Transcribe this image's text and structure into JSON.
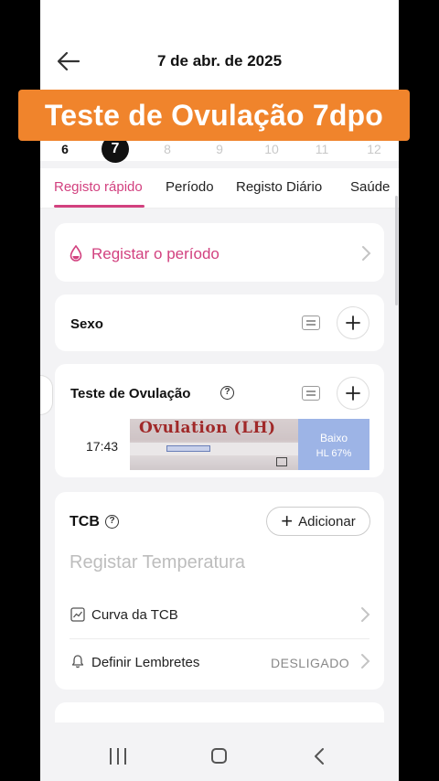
{
  "header": {
    "date_title": "7 de abr. de 2025"
  },
  "overlay": {
    "caption": "Teste de Ovulação 7dpo"
  },
  "day_strip": {
    "days": [
      "6",
      "7",
      "8",
      "9",
      "10",
      "11",
      "12"
    ],
    "selected_index": 1
  },
  "tabs": [
    {
      "label": "Registo rápido",
      "active": true
    },
    {
      "label": "Período",
      "active": false
    },
    {
      "label": "Registo Diário",
      "active": false
    },
    {
      "label": "Saúde",
      "active": false
    }
  ],
  "period_card": {
    "label": "Registar o período"
  },
  "sex_card": {
    "title": "Sexo"
  },
  "ovulation_card": {
    "title": "Teste de Ovulação",
    "entry_time": "17:43",
    "image_text": "Ovulation (LH)",
    "result_label": "Baixo",
    "result_value": "HL 67%"
  },
  "bbt_card": {
    "title": "TCB",
    "add_label": "Adicionar",
    "temperature_placeholder": "Registar Temperatura",
    "curve_label": "Curva da TCB",
    "reminders_label": "Definir Lembretes",
    "reminders_value": "DESLIGADO"
  },
  "colors": {
    "accent": "#d2417f",
    "banner": "#f0842c",
    "result_badge": "#9db4e6",
    "background": "#f3f3f5"
  }
}
